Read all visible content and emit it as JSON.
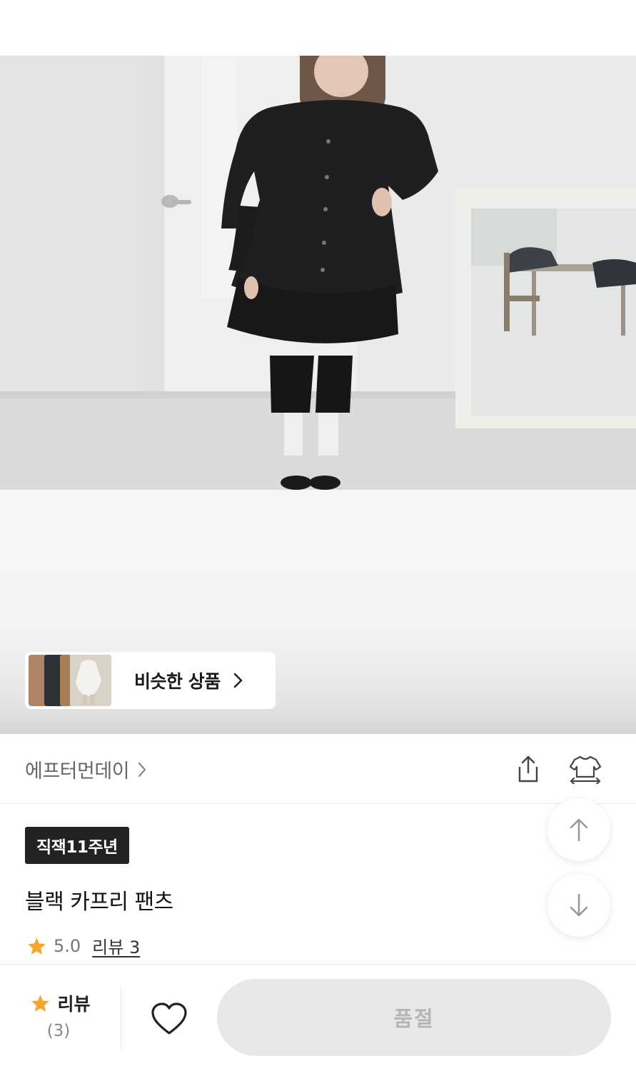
{
  "similar": {
    "label": "비슷한 상품"
  },
  "brand": {
    "name": "에프터먼데이"
  },
  "product": {
    "badge": "직잭11주년",
    "title": "블랙 카프리 팬츠",
    "rating": "5.0",
    "review_link": "리뷰 3"
  },
  "bottom_bar": {
    "review_label": "리뷰",
    "review_count": "(3)",
    "buy_label": "품절"
  },
  "icons": {
    "chevron": "chevron-right-icon",
    "share": "share-icon",
    "size": "garment-size-icon",
    "star": "star-icon",
    "heart": "heart-icon",
    "up": "arrow-up-icon",
    "down": "arrow-down-icon"
  },
  "colors": {
    "star": "#f7a531",
    "badge_bg": "#222222",
    "soldout_bg": "#e8e8ea",
    "soldout_text": "#b5b5b5"
  }
}
